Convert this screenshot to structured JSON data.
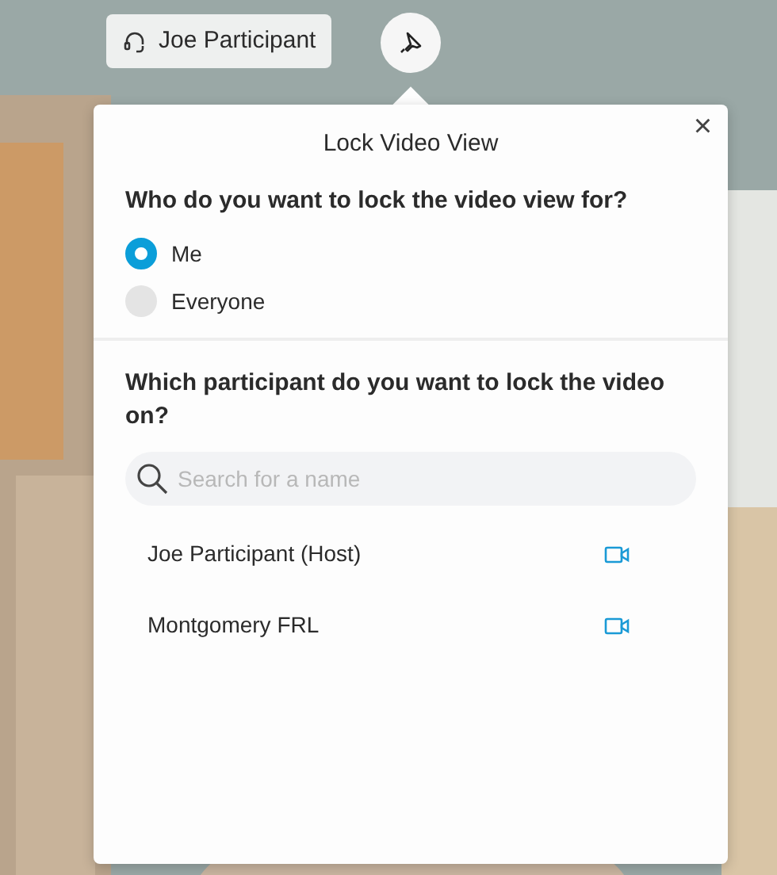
{
  "name_tag": {
    "name": "Joe Participant"
  },
  "dialog": {
    "title": "Lock Video View",
    "close": "×",
    "scope_question": "Who do you want to lock the video view for?",
    "scope_options": [
      {
        "label": "Me",
        "selected": true
      },
      {
        "label": "Everyone",
        "selected": false
      }
    ],
    "participant_question": "Which participant do you want to lock the video on?",
    "search": {
      "placeholder": "Search for a name"
    },
    "participants": [
      {
        "name": "Joe Participant (Host)"
      },
      {
        "name": "Montgomery FRL"
      }
    ]
  }
}
